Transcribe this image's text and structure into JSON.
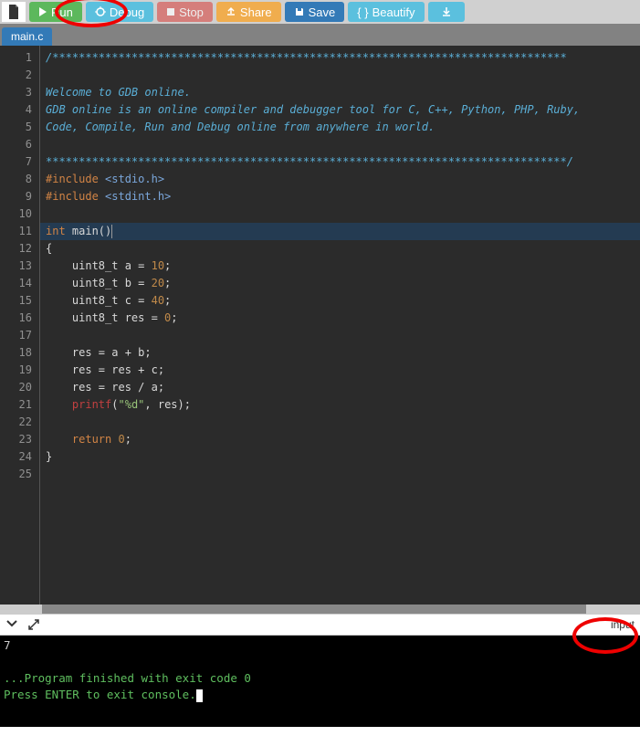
{
  "toolbar": {
    "run": "Run",
    "debug": "Debug",
    "stop": "Stop",
    "share": "Share",
    "save": "Save",
    "beautify": "Beautify"
  },
  "tab": {
    "name": "main.c"
  },
  "editor": {
    "highlight_line": 11,
    "lines": [
      {
        "tokens": [
          {
            "c": "cm1",
            "t": "/******************************************************************************"
          }
        ]
      },
      {
        "tokens": []
      },
      {
        "tokens": [
          {
            "c": "cm1",
            "t": "Welcome to GDB online."
          }
        ]
      },
      {
        "tokens": [
          {
            "c": "cm1",
            "t": "GDB online is an online compiler and debugger tool for C, C++, Python, PHP, Ruby, "
          }
        ]
      },
      {
        "tokens": [
          {
            "c": "cm1",
            "t": "Code, Compile, Run and Debug online from anywhere in world."
          }
        ]
      },
      {
        "tokens": []
      },
      {
        "tokens": [
          {
            "c": "cm1",
            "t": "*******************************************************************************/"
          }
        ]
      },
      {
        "tokens": [
          {
            "c": "cm2",
            "t": "#include "
          },
          {
            "c": "cm3",
            "t": "<stdio.h>"
          }
        ]
      },
      {
        "tokens": [
          {
            "c": "cm2",
            "t": "#include "
          },
          {
            "c": "cm3",
            "t": "<stdint.h>"
          }
        ]
      },
      {
        "tokens": []
      },
      {
        "tokens": [
          {
            "c": "cm2",
            "t": "int "
          },
          {
            "c": "cm4",
            "t": "main()"
          }
        ]
      },
      {
        "tokens": [
          {
            "c": "cm4",
            "t": "{"
          }
        ]
      },
      {
        "tokens": [
          {
            "c": "cm4",
            "t": "    uint8_t a = "
          },
          {
            "c": "cm5",
            "t": "10"
          },
          {
            "c": "cm4",
            "t": ";"
          }
        ]
      },
      {
        "tokens": [
          {
            "c": "cm4",
            "t": "    uint8_t b = "
          },
          {
            "c": "cm5",
            "t": "20"
          },
          {
            "c": "cm4",
            "t": ";"
          }
        ]
      },
      {
        "tokens": [
          {
            "c": "cm4",
            "t": "    uint8_t c = "
          },
          {
            "c": "cm5",
            "t": "40"
          },
          {
            "c": "cm4",
            "t": ";"
          }
        ]
      },
      {
        "tokens": [
          {
            "c": "cm4",
            "t": "    uint8_t res = "
          },
          {
            "c": "cm5",
            "t": "0"
          },
          {
            "c": "cm4",
            "t": ";"
          }
        ]
      },
      {
        "tokens": [
          {
            "c": "cm4",
            "t": "    "
          }
        ]
      },
      {
        "tokens": [
          {
            "c": "cm4",
            "t": "    res = a + b;"
          }
        ]
      },
      {
        "tokens": [
          {
            "c": "cm4",
            "t": "    res = res + c;"
          }
        ]
      },
      {
        "tokens": [
          {
            "c": "cm4",
            "t": "    res = res / a;"
          }
        ]
      },
      {
        "tokens": [
          {
            "c": "cm4",
            "t": "    "
          },
          {
            "c": "cm6",
            "t": "printf"
          },
          {
            "c": "cm4",
            "t": "("
          },
          {
            "c": "cm7",
            "t": "\"%d\""
          },
          {
            "c": "cm4",
            "t": ", res);"
          }
        ]
      },
      {
        "tokens": []
      },
      {
        "tokens": [
          {
            "c": "cm4",
            "t": "    "
          },
          {
            "c": "cm2",
            "t": "return"
          },
          {
            "c": "cm4",
            "t": " "
          },
          {
            "c": "cm5",
            "t": "0"
          },
          {
            "c": "cm4",
            "t": ";"
          }
        ]
      },
      {
        "tokens": [
          {
            "c": "cm4",
            "t": "}"
          }
        ]
      },
      {
        "tokens": []
      }
    ]
  },
  "midbar": {
    "right_label": "input"
  },
  "console": {
    "output_value": "7",
    "finished": "...Program finished with exit code 0",
    "prompt": "Press ENTER to exit console."
  }
}
